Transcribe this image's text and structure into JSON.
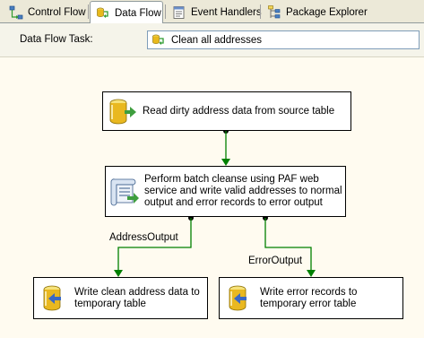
{
  "tabs": [
    {
      "label": "Control Flow",
      "icon": "control-flow-icon",
      "active": false
    },
    {
      "label": "Data Flow",
      "icon": "data-flow-icon",
      "active": true
    },
    {
      "label": "Event Handlers",
      "icon": "event-handlers-icon",
      "active": false
    },
    {
      "label": "Package Explorer",
      "icon": "package-explorer-icon",
      "active": false
    }
  ],
  "task_bar": {
    "label": "Data Flow Task:",
    "selected_task": "Clean all addresses",
    "selected_icon": "data-flow-task-icon"
  },
  "components": {
    "source": {
      "label": "Read dirty address data from source table",
      "icon": "ole-db-source-icon"
    },
    "script": {
      "label": "Perform batch cleanse using PAF web\nservice and write valid addresses to normal\noutput and error records to error output",
      "icon": "script-component-icon"
    },
    "dest_clean": {
      "label": "Write clean address data to\ntemporary table",
      "icon": "ole-db-destination-icon"
    },
    "dest_error": {
      "label": "Write error records to\ntemporary error table",
      "icon": "ole-db-destination-icon"
    }
  },
  "paths": {
    "output_label": "AddressOutput",
    "error_label": "ErrorOutput"
  },
  "colors": {
    "canvas_bg": "#FFFBF0",
    "path_green": "#008000",
    "tab_strip": "#ECE9D8"
  }
}
